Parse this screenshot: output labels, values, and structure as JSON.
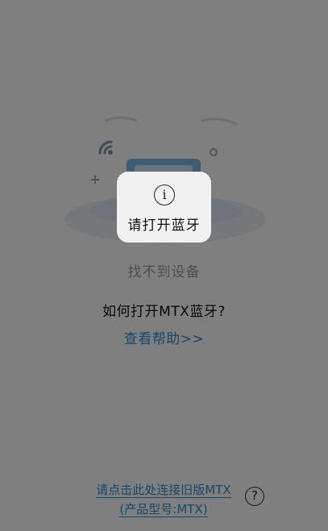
{
  "main": {
    "status_text": "找不到设备",
    "question": "如何打开MTX蓝牙?",
    "help_link": "查看帮助>>",
    "legacy_link_line1": "请点击此处连接旧版MTX",
    "legacy_link_line2": "(产品型号:MTX)",
    "help_icon_glyph": "?"
  },
  "toast": {
    "icon_glyph": "i",
    "message": "请打开蓝牙"
  },
  "colors": {
    "link": "#2f8fd6",
    "overlay": "rgba(0,0,0,0.5)",
    "toast_bg": "#f1f1f1"
  }
}
